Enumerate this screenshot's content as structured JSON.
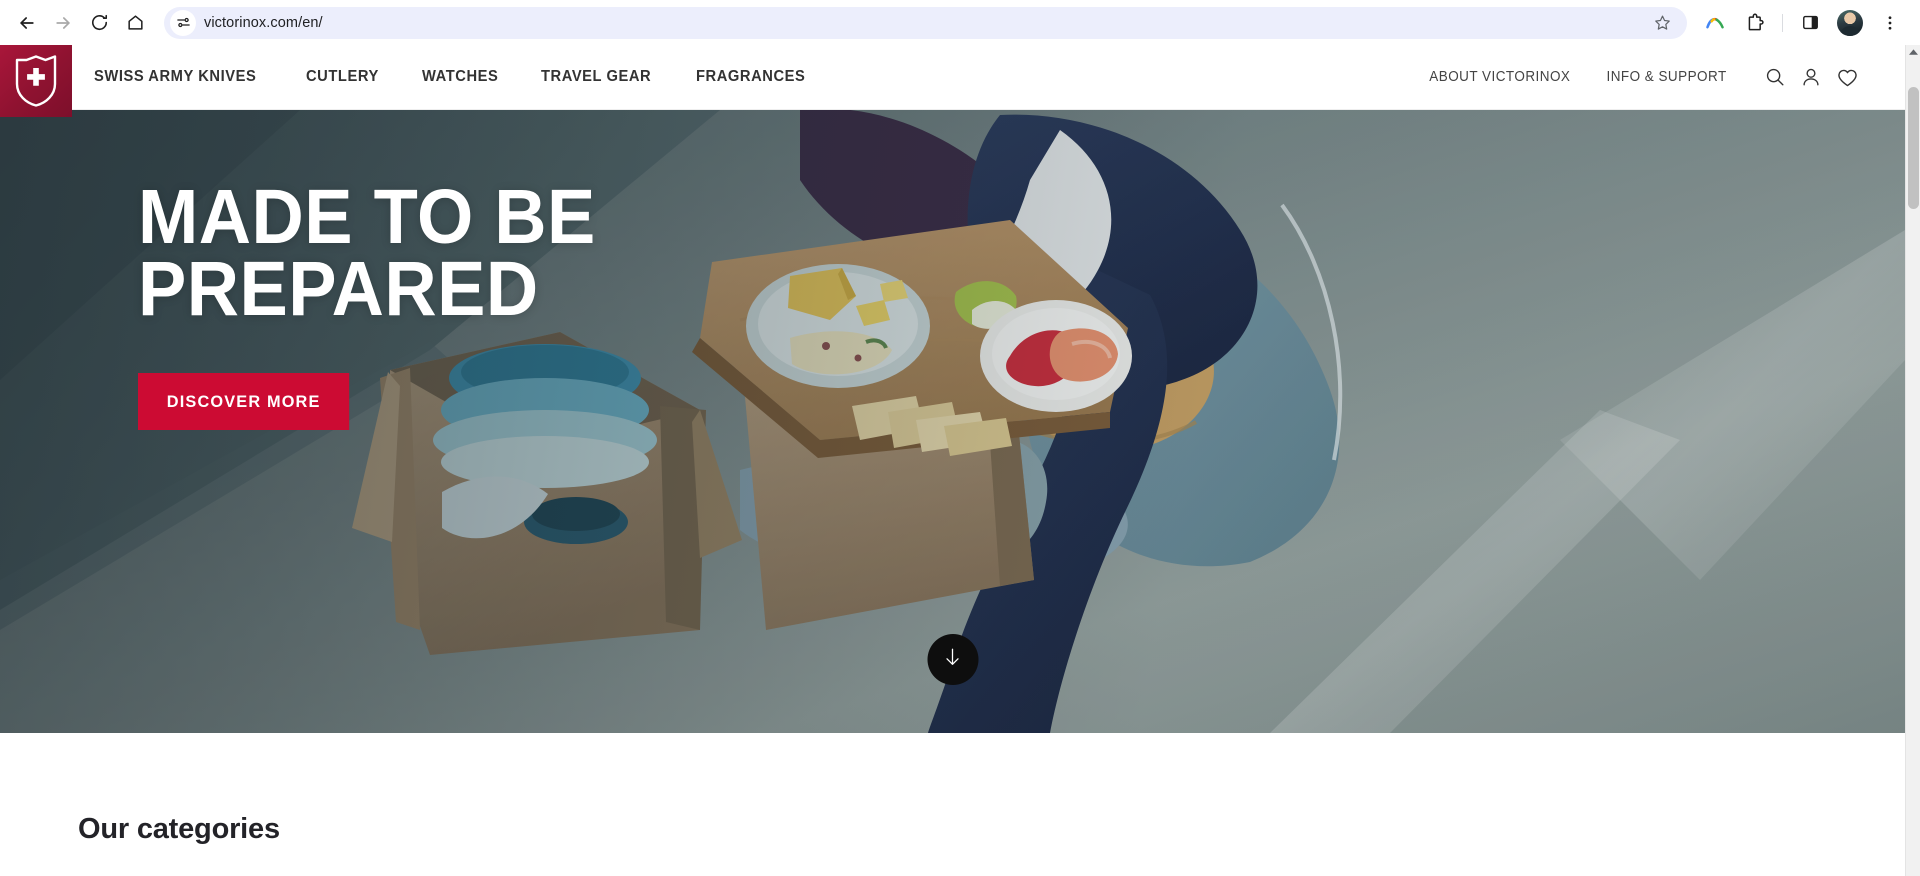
{
  "browser": {
    "back_label": "Back",
    "forward_label": "Forward",
    "reload_label": "Reload",
    "home_label": "Home",
    "url": "victorinox.com/en/",
    "site_settings_icon": "tune-icon",
    "bookmark_icon": "star-icon",
    "google_lens_icon": "google-arc-icon",
    "extensions_icon": "puzzle-piece-icon",
    "side_panel_icon": "side-panel-icon",
    "profile_icon": "profile-avatar",
    "menu_icon": "three-dot-menu-icon"
  },
  "site": {
    "brand": "Victorinox",
    "logo_icon": "victorinox-shield-cross-logo",
    "nav": [
      {
        "label": "SWISS ARMY KNIVES"
      },
      {
        "label": "CUTLERY"
      },
      {
        "label": "WATCHES"
      },
      {
        "label": "TRAVEL GEAR"
      },
      {
        "label": "FRAGRANCES"
      }
    ],
    "utility": [
      {
        "label": "ABOUT VICTORINOX"
      },
      {
        "label": "INFO & SUPPORT"
      }
    ],
    "icons": {
      "search": "search-icon",
      "account": "user-account-icon",
      "wishlist": "heart-wishlist-icon"
    }
  },
  "hero": {
    "title_line1": "MADE TO BE",
    "title_line2": "PREPARED",
    "cta_label": "DISCOVER MORE",
    "scroll_hint_icon": "arrow-down-icon",
    "image_alt": "Person sitting on blankets beside a cardboard box of blue dishware with a wooden board of cheese, crackers, apple slices and salmon"
  },
  "main": {
    "section_title": "Our categories"
  },
  "colors": {
    "brand_red": "#a9163a",
    "cta_red": "#cc0b33",
    "hero_backdrop": "#4a5b60",
    "text_dark": "#232328",
    "omnibox_bg": "#eceefc"
  }
}
